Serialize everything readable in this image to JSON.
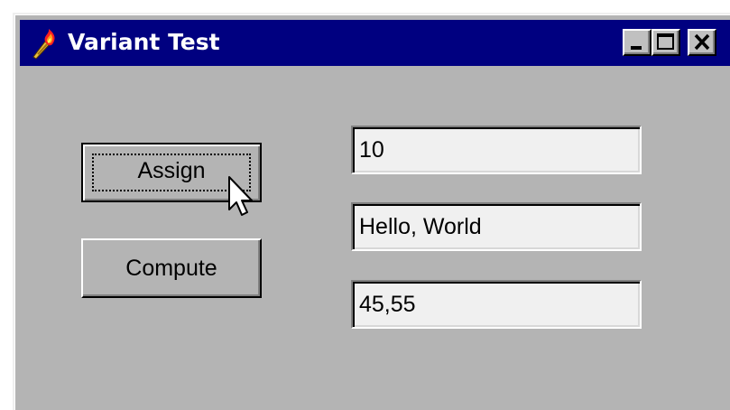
{
  "window": {
    "title": "Variant Test",
    "app_icon": "torch-icon",
    "controls": {
      "minimize": "minimize-icon",
      "maximize": "maximize-icon",
      "close": "close-icon"
    }
  },
  "buttons": {
    "assign_label": "Assign",
    "compute_label": "Compute"
  },
  "fields": {
    "field1_value": "10",
    "field2_value": "Hello, World",
    "field3_value": "45,55"
  },
  "colors": {
    "titlebar": "#000080",
    "face": "#b4b4b4",
    "field_bg": "#f0f0f0"
  },
  "pointer": "arrow-cursor-icon"
}
